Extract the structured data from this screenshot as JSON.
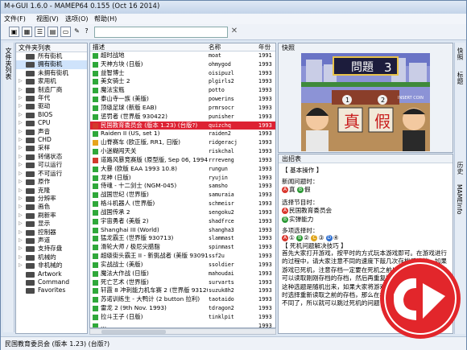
{
  "window": {
    "title": "M+GUI 1.6.0 - MAMEP64 0.155 (Oct 16 2014)"
  },
  "menu": [
    "文件(F)",
    "视图(V)",
    "选项(O)",
    "帮助(H)"
  ],
  "folders": {
    "tab_label": "文件夹列表",
    "header": "文件夹列表",
    "items": [
      "所有街机",
      "拥有街机",
      "未拥有街机",
      "家用机",
      "制造厂商",
      "年代",
      "驱动",
      "BIOS",
      "CPU",
      "声音",
      "CHD",
      "采样",
      "转储状态",
      "可以运行",
      "不可运行",
      "原作",
      "克隆",
      "分辨率",
      "画色",
      "刷新率",
      "显示",
      "控制器",
      "声道",
      "支持存盘",
      "机械的",
      "非机械的",
      "Artwork",
      "Command",
      "Favorites"
    ],
    "selected": 1
  },
  "games": {
    "columns": {
      "desc": "描述",
      "name": "名称",
      "year": "年份"
    },
    "rows": [
      {
        "desc": "超时战地",
        "rom": "moat",
        "year": "1991",
        "icon": "green"
      },
      {
        "desc": "天神方块 (日版)",
        "rom": "ohmygod",
        "year": "1993",
        "icon": "green"
      },
      {
        "desc": "益智博士",
        "rom": "oisipuzl",
        "year": "1993",
        "icon": "green"
      },
      {
        "desc": "美女骑士 2",
        "rom": "plgirls2",
        "year": "1993",
        "icon": "green"
      },
      {
        "desc": "魔法宝瓶",
        "rom": "potto",
        "year": "1993",
        "icon": "green"
      },
      {
        "desc": "泰山寺一族 (美版)",
        "rom": "powerins",
        "year": "1993",
        "icon": "green"
      },
      {
        "desc": "顶级足球 (新版 EAB)",
        "rom": "prmrsocr",
        "year": "1993",
        "icon": "green"
      },
      {
        "desc": "惩罚者 (世界版 930422)",
        "rom": "punisher",
        "year": "1993",
        "icon": "green"
      },
      {
        "desc": "民国教育委员会 (版本 1.23) (台版?)",
        "rom": "quizchq",
        "year": "1993",
        "icon": "red"
      },
      {
        "desc": "Raiden II (US, set 1)",
        "rom": "raiden2",
        "year": "1993",
        "icon": "green"
      },
      {
        "desc": "山脊赛车 (欧正版, RR1, 日版)",
        "rom": "ridgeracj",
        "year": "1993",
        "icon": "yellow"
      },
      {
        "desc": "小迷糊闯天关",
        "rom": "riskchal",
        "year": "1993",
        "icon": "green"
      },
      {
        "desc": "道路风暴竞赛版 (原型版, Sep 06, 1994)",
        "rom": "rrreveng",
        "year": "1993",
        "icon": "red"
      },
      {
        "desc": "大暴 (欧版 EAA 1993 10.8)",
        "rom": "rungun",
        "year": "1993",
        "icon": "green"
      },
      {
        "desc": "龙神 (日版)",
        "rom": "ryujin",
        "year": "1993",
        "icon": "green"
      },
      {
        "desc": "侍魂 - 十二剑士 (NGM-045)",
        "rom": "samsho",
        "year": "1993",
        "icon": "green"
      },
      {
        "desc": "战国世纪 (世界版)",
        "rom": "samuraia",
        "year": "1993",
        "icon": "green"
      },
      {
        "desc": "格斗机器人 (世界版)",
        "rom": "schmeisr",
        "year": "1993",
        "icon": "green"
      },
      {
        "desc": "战国传承 2",
        "rom": "sengoku2",
        "year": "1993",
        "icon": "green"
      },
      {
        "desc": "宇宙勇者 (美版 2)",
        "rom": "shadfrce",
        "year": "1993",
        "icon": "green"
      },
      {
        "desc": "Shanghai III (World)",
        "rom": "shangha3",
        "year": "1993",
        "icon": "green"
      },
      {
        "desc": "猛龙霸王 (世界版 930713)",
        "rom": "slammast",
        "year": "1993",
        "icon": "green"
      },
      {
        "desc": "滑轮大师 / 极尼尖腊脂",
        "rom": "spinmast",
        "year": "1993",
        "icon": "green"
      },
      {
        "desc": "超级街头霸王 II - 新挑战者 (美版 930911)",
        "rom": "ssf2u",
        "year": "1993",
        "icon": "green"
      },
      {
        "desc": "实战战士 (美版)",
        "rom": "ssoldier",
        "year": "1993",
        "icon": "green"
      },
      {
        "desc": "魔法大作战 (日版)",
        "rom": "mahoudai",
        "year": "1993",
        "icon": "green"
      },
      {
        "desc": "死亡艺术 (世界版)",
        "rom": "survarts",
        "year": "1993",
        "icon": "green"
      },
      {
        "desc": "轩霞 8 冲刺能力机车赛 2 (世界版 931208)",
        "rom": "suzuk8h2",
        "year": "1993",
        "icon": "green"
      },
      {
        "desc": "苏诺训练生 - 大鸭计 (2 button 拉利)",
        "rom": "taotaido",
        "year": "1993",
        "icon": "green"
      },
      {
        "desc": "雷龙 2 (9th Nov. 1993)",
        "rom": "tdragon2",
        "year": "1993",
        "icon": "green"
      },
      {
        "desc": "拉斗王子 (日版)",
        "rom": "tinklpit",
        "year": "1993",
        "icon": "green"
      },
      {
        "desc": "...",
        "rom": "",
        "year": "1993",
        "icon": "green"
      }
    ],
    "selected": 8
  },
  "snapshot": {
    "header": "快照",
    "screen_text": {
      "top": "問題",
      "number": "3",
      "answer1": "真",
      "answer2": "假",
      "badge1": "1",
      "badge2": "2",
      "corner": "INSERT COIN"
    }
  },
  "history": {
    "header": "出招表",
    "section_basic": "【 基本操作 】",
    "q1_label": "新闻问题时：",
    "q1_opts": [
      {
        "btn": "A",
        "col": "r",
        "text": "真"
      },
      {
        "btn": "B",
        "col": "g",
        "text": "假"
      }
    ],
    "q2_label": "选择节目时：",
    "q2_opts": [
      {
        "btn": "A",
        "col": "r",
        "text": "民国教育委员会"
      },
      {
        "btn": "B",
        "col": "g",
        "text": "实弹能力"
      }
    ],
    "q3_label": "多项选择时：",
    "q3_btns": [
      {
        "btn": "A",
        "col": "r",
        "text": "①"
      },
      {
        "btn": "B",
        "col": "g",
        "text": "②"
      },
      {
        "btn": "C",
        "col": "y",
        "text": "③"
      },
      {
        "btn": "D",
        "col": "b",
        "text": "④"
      }
    ],
    "section_tips": "【 死机问题解决技巧 】",
    "paragraph": "首先大家打开游戏，按平时的方式玩本游戏即可。在游戏进行的过程中，请大家注意不同的速度下敲几次存档后读档，如果游戏已死机，注意存档一定要在死机之前！当游戏死机时大家可以读取刚刚存档的存档，然后再重复操作的进行。其实游戏这种选题是随机出来，如果大家将游戏进行到某一个存档选项时选择重新读取之前的存档，那么在相同的位置出现的问题就不同了，所以就可以跳过死机的问题了。"
  },
  "right_tabs": [
    "快照",
    "标题",
    "历史",
    "MAMEInfo"
  ],
  "status": "民国教育委员会 (版本 1.23) (台版?)"
}
